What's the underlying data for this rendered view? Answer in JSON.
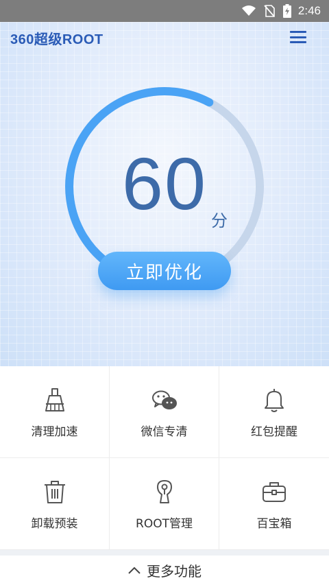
{
  "status_bar": {
    "time": "2:46",
    "icons": [
      "wifi-icon",
      "no-sim-icon",
      "battery-charging-icon"
    ]
  },
  "header": {
    "logo_text": "360超级ROOT",
    "menu_icon": "hamburger-menu-icon"
  },
  "score_panel": {
    "score": "60",
    "unit": "分",
    "progress_fraction": 0.6,
    "progress_color": "#4aa3f5",
    "track_color": "#c6d6eb",
    "action_label": "立即优化"
  },
  "features": [
    {
      "label": "清理加速",
      "icon": "broom-icon"
    },
    {
      "label": "微信专清",
      "icon": "wechat-icon"
    },
    {
      "label": "红包提醒",
      "icon": "bell-icon"
    },
    {
      "label": "卸载预装",
      "icon": "trash-icon"
    },
    {
      "label": "ROOT管理",
      "icon": "keyhole-icon"
    },
    {
      "label": "百宝箱",
      "icon": "toolbox-icon"
    }
  ],
  "footer": {
    "more_label": "更多功能",
    "icon": "chevron-up-icon"
  }
}
